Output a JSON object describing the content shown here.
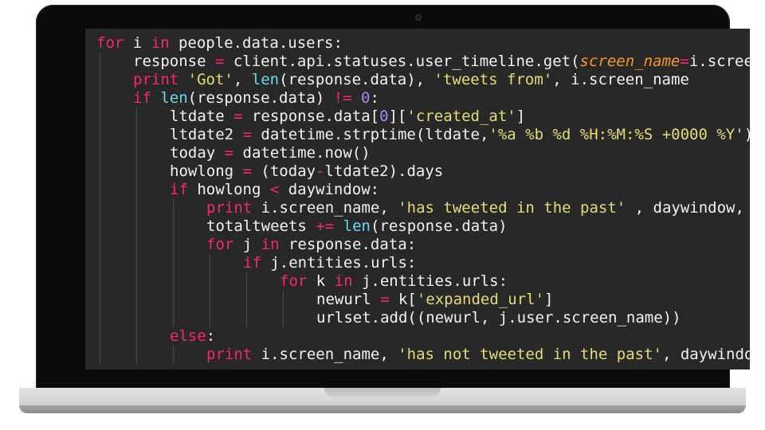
{
  "code_lines": [
    {
      "indent": 0,
      "tokens": [
        [
          "kw",
          "for"
        ],
        [
          "plain",
          " i "
        ],
        [
          "kw",
          "in"
        ],
        [
          "plain",
          " people.data.users:"
        ]
      ]
    },
    {
      "indent": 1,
      "tokens": [
        [
          "plain",
          "response "
        ],
        [
          "op",
          "="
        ],
        [
          "plain",
          " client.api.statuses.user_timeline.get("
        ],
        [
          "param",
          "screen_name"
        ],
        [
          "op",
          "="
        ],
        [
          "plain",
          "i.screen_name"
        ]
      ]
    },
    {
      "indent": 1,
      "tokens": [
        [
          "kw",
          "print"
        ],
        [
          "plain",
          " "
        ],
        [
          "str",
          "'Got'"
        ],
        [
          "plain",
          ", "
        ],
        [
          "bi",
          "len"
        ],
        [
          "plain",
          "(response.data), "
        ],
        [
          "str",
          "'tweets from'"
        ],
        [
          "plain",
          ", i.screen_name"
        ]
      ]
    },
    {
      "indent": 1,
      "tokens": [
        [
          "kw",
          "if"
        ],
        [
          "plain",
          " "
        ],
        [
          "bi",
          "len"
        ],
        [
          "plain",
          "(response.data) "
        ],
        [
          "op",
          "!="
        ],
        [
          "plain",
          " "
        ],
        [
          "num",
          "0"
        ],
        [
          "plain",
          ":"
        ]
      ]
    },
    {
      "indent": 2,
      "tokens": [
        [
          "plain",
          "ltdate "
        ],
        [
          "op",
          "="
        ],
        [
          "plain",
          " response.data["
        ],
        [
          "num",
          "0"
        ],
        [
          "plain",
          "]["
        ],
        [
          "str",
          "'created_at'"
        ],
        [
          "plain",
          "]"
        ]
      ]
    },
    {
      "indent": 2,
      "tokens": [
        [
          "plain",
          "ltdate2 "
        ],
        [
          "op",
          "="
        ],
        [
          "plain",
          " datetime.strptime(ltdate,"
        ],
        [
          "str",
          "'%a %b %d %H:%M:%S +0000 %Y'"
        ],
        [
          "plain",
          ")"
        ]
      ]
    },
    {
      "indent": 2,
      "tokens": [
        [
          "plain",
          "today "
        ],
        [
          "op",
          "="
        ],
        [
          "plain",
          " datetime.now()"
        ]
      ]
    },
    {
      "indent": 2,
      "tokens": [
        [
          "plain",
          "howlong "
        ],
        [
          "op",
          "="
        ],
        [
          "plain",
          " (today"
        ],
        [
          "op",
          "-"
        ],
        [
          "plain",
          "ltdate2).days"
        ]
      ]
    },
    {
      "indent": 2,
      "tokens": [
        [
          "kw",
          "if"
        ],
        [
          "plain",
          " howlong "
        ],
        [
          "op",
          "<"
        ],
        [
          "plain",
          " daywindow:"
        ]
      ]
    },
    {
      "indent": 3,
      "tokens": [
        [
          "kw",
          "print"
        ],
        [
          "plain",
          " i.screen_name, "
        ],
        [
          "str",
          "'has tweeted in the past'"
        ],
        [
          "plain",
          " , daywindow, "
        ]
      ]
    },
    {
      "indent": 3,
      "tokens": [
        [
          "plain",
          "totaltweets "
        ],
        [
          "op",
          "+="
        ],
        [
          "plain",
          " "
        ],
        [
          "bi",
          "len"
        ],
        [
          "plain",
          "(response.data)"
        ]
      ]
    },
    {
      "indent": 3,
      "tokens": [
        [
          "kw",
          "for"
        ],
        [
          "plain",
          " j "
        ],
        [
          "kw",
          "in"
        ],
        [
          "plain",
          " response.data:"
        ]
      ]
    },
    {
      "indent": 4,
      "tokens": [
        [
          "kw",
          "if"
        ],
        [
          "plain",
          " j.entities.urls:"
        ]
      ]
    },
    {
      "indent": 5,
      "tokens": [
        [
          "kw",
          "for"
        ],
        [
          "plain",
          " k "
        ],
        [
          "kw",
          "in"
        ],
        [
          "plain",
          " j.entities.urls:"
        ]
      ]
    },
    {
      "indent": 6,
      "tokens": [
        [
          "plain",
          "newurl "
        ],
        [
          "op",
          "="
        ],
        [
          "plain",
          " k["
        ],
        [
          "str",
          "'expanded_url'"
        ],
        [
          "plain",
          "]"
        ]
      ]
    },
    {
      "indent": 6,
      "tokens": [
        [
          "plain",
          "urlset.add((newurl, j.user.screen_name))"
        ]
      ]
    },
    {
      "indent": 2,
      "tokens": [
        [
          "kw",
          "else"
        ],
        [
          "plain",
          ":"
        ]
      ]
    },
    {
      "indent": 3,
      "tokens": [
        [
          "kw",
          "print"
        ],
        [
          "plain",
          " i.screen_name, "
        ],
        [
          "str",
          "'has not tweeted in the past'"
        ],
        [
          "plain",
          ", daywindow"
        ]
      ]
    }
  ],
  "colors": {
    "screen_bg": "#282828",
    "keyword": "#f92672",
    "builtin": "#66d9ef",
    "string": "#e6db74",
    "number": "#ae81ff",
    "parameter": "#fd971f",
    "text": "#f2f2ee"
  }
}
